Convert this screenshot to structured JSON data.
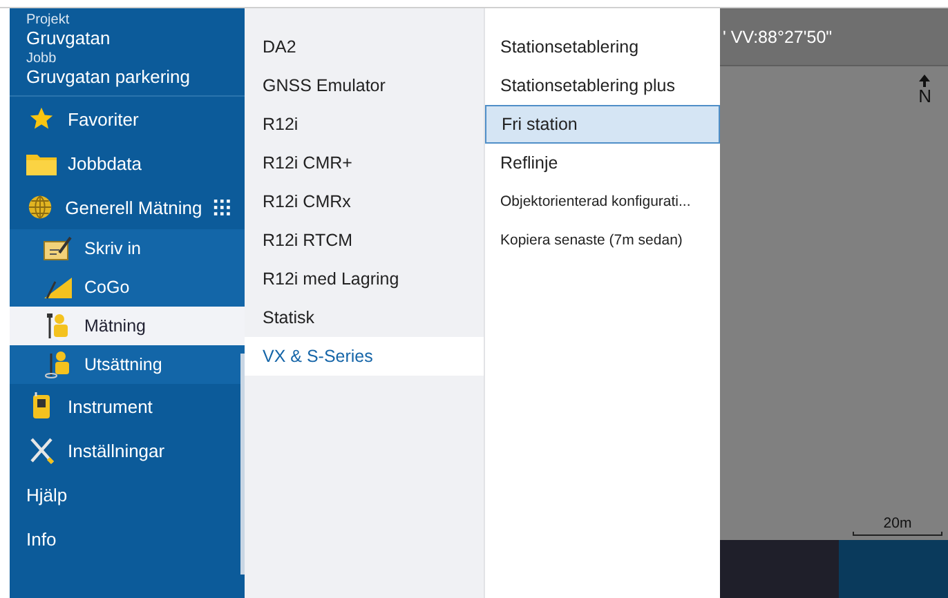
{
  "project": {
    "label": "Projekt",
    "value": "Gruvgatan"
  },
  "job": {
    "label": "Jobb",
    "value": "Gruvgatan parkering"
  },
  "sidebar": {
    "items": [
      {
        "label": "Favoriter",
        "kind": "main",
        "selected": false
      },
      {
        "label": "Jobbdata",
        "kind": "main",
        "selected": false
      },
      {
        "label": "Generell Mätning",
        "kind": "group",
        "selected": false
      },
      {
        "label": "Skriv in",
        "kind": "sub",
        "selected": false
      },
      {
        "label": "CoGo",
        "kind": "sub",
        "selected": false
      },
      {
        "label": "Mätning",
        "kind": "sub",
        "selected": true
      },
      {
        "label": "Utsättning",
        "kind": "sub",
        "selected": false
      },
      {
        "label": "Instrument",
        "kind": "main",
        "selected": false
      },
      {
        "label": "Inställningar",
        "kind": "main",
        "selected": false
      },
      {
        "label": "Hjälp",
        "kind": "plain",
        "selected": false
      },
      {
        "label": "Info",
        "kind": "plain",
        "selected": false
      }
    ]
  },
  "styles": [
    {
      "label": "DA2",
      "selected": false
    },
    {
      "label": "GNSS Emulator",
      "selected": false
    },
    {
      "label": "R12i",
      "selected": false
    },
    {
      "label": "R12i CMR+",
      "selected": false
    },
    {
      "label": "R12i CMRx",
      "selected": false
    },
    {
      "label": "R12i RTCM",
      "selected": false
    },
    {
      "label": "R12i med Lagring",
      "selected": false
    },
    {
      "label": "Statisk",
      "selected": false
    },
    {
      "label": "VX & S-Series",
      "selected": true
    }
  ],
  "actions": [
    {
      "label": "Stationsetablering",
      "selected": false,
      "kind": "normal"
    },
    {
      "label": "Stationsetablering plus",
      "selected": false,
      "kind": "normal"
    },
    {
      "label": "Fri station",
      "selected": true,
      "kind": "normal"
    },
    {
      "label": "Reflinje",
      "selected": false,
      "kind": "normal"
    },
    {
      "label": "Objektorienterad konfigurati...",
      "selected": false,
      "kind": "small"
    },
    {
      "label": "Kopiera senaste (7m sedan)",
      "selected": false,
      "kind": "small"
    }
  ],
  "map": {
    "status": "' VV:88°27'50\"",
    "north": "N",
    "scale": "20m"
  }
}
